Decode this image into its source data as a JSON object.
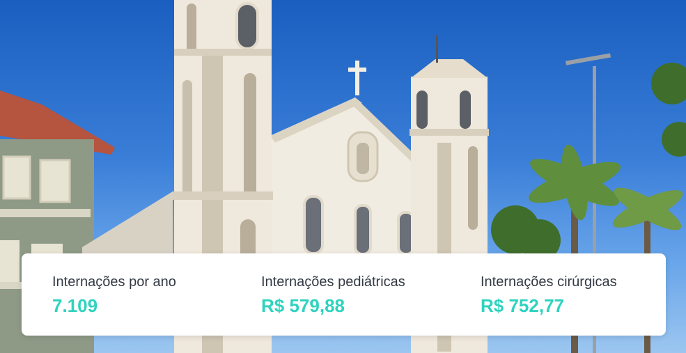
{
  "stats": [
    {
      "label": "Internações por ano",
      "value": "7.109"
    },
    {
      "label": "Internações pediátricas",
      "value": "R$ 579,88"
    },
    {
      "label": "Internações cirúrgicas",
      "value": "R$ 752,77"
    }
  ],
  "colors": {
    "value_accent": "#2ed3bf",
    "label_text": "#333a44",
    "card_background": "#ffffff",
    "sky": "#2f74d0"
  }
}
